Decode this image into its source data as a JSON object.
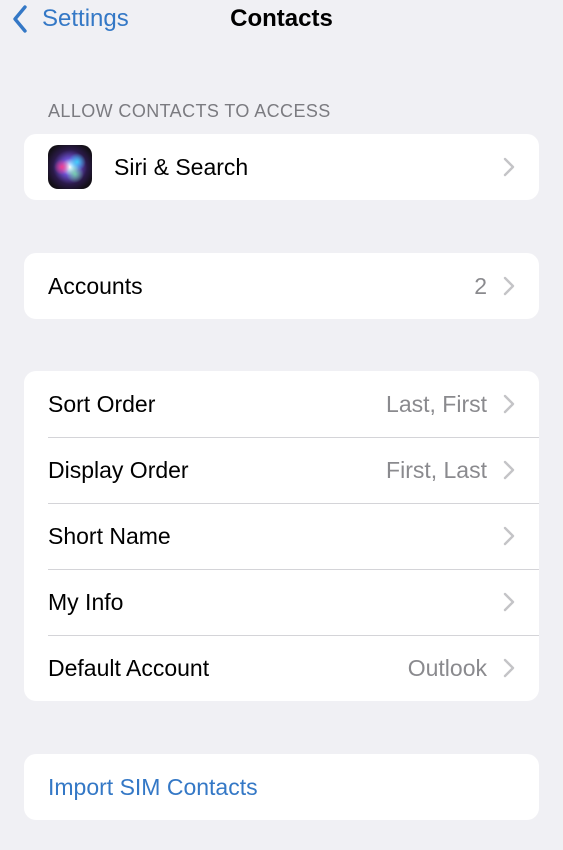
{
  "nav": {
    "back_label": "Settings",
    "title": "Contacts",
    "back_icon": "chevron-left-icon"
  },
  "allow_section": {
    "header": "ALLOW CONTACTS TO ACCESS",
    "items": [
      {
        "label": "Siri & Search",
        "icon": "siri-icon"
      }
    ]
  },
  "accounts": {
    "label": "Accounts",
    "value": "2"
  },
  "options": [
    {
      "label": "Sort Order",
      "value": "Last, First"
    },
    {
      "label": "Display Order",
      "value": "First, Last"
    },
    {
      "label": "Short Name",
      "value": ""
    },
    {
      "label": "My Info",
      "value": ""
    },
    {
      "label": "Default Account",
      "value": "Outlook"
    }
  ],
  "import": {
    "label": "Import SIM Contacts"
  },
  "colors": {
    "background": "#f0f0f4",
    "accent": "#3478c6",
    "secondary_text": "#8a8a8e",
    "chevron": "#c4c4c7"
  }
}
